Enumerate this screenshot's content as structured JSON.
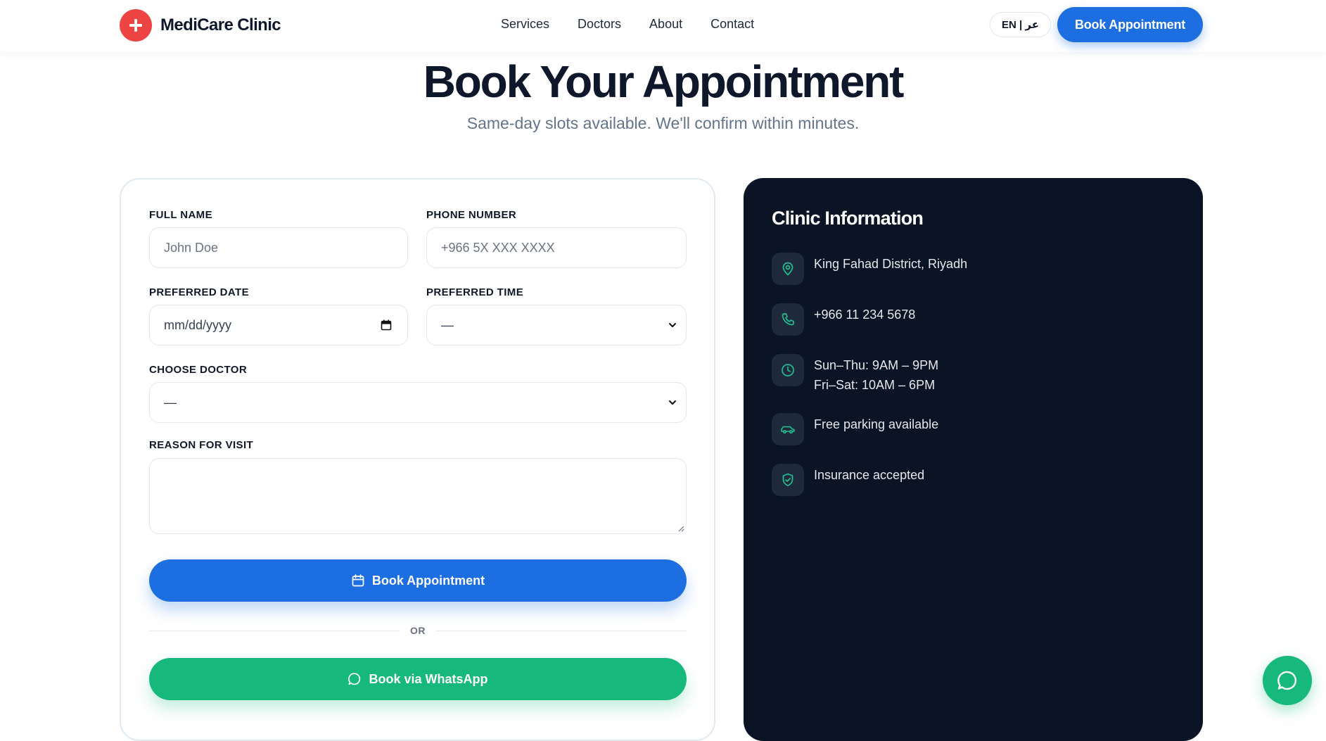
{
  "header": {
    "brand_name": "MediCare Clinic",
    "nav": [
      "Services",
      "Doctors",
      "About",
      "Contact"
    ],
    "lang_toggle": "EN | عر",
    "cta": "Book Appointment"
  },
  "hero": {
    "title": "Book Your Appointment",
    "subtitle": "Same-day slots available. We'll confirm within minutes."
  },
  "form": {
    "full_name": {
      "label": "FULL NAME",
      "placeholder": "John Doe"
    },
    "phone": {
      "label": "PHONE NUMBER",
      "placeholder": "+966 5X XXX XXXX"
    },
    "date": {
      "label": "PREFERRED DATE",
      "placeholder": "mm/dd/yyyy"
    },
    "time": {
      "label": "PREFERRED TIME",
      "value": "—"
    },
    "doctor": {
      "label": "CHOOSE DOCTOR",
      "value": "—"
    },
    "reason": {
      "label": "REASON FOR VISIT"
    },
    "submit": "Book Appointment",
    "divider": "OR",
    "whatsapp": "Book via WhatsApp"
  },
  "info": {
    "title": "Clinic Information",
    "items": [
      {
        "icon": "location-pin-icon",
        "lines": [
          "King Fahad District, Riyadh"
        ]
      },
      {
        "icon": "phone-icon",
        "lines": [
          "+966 11 234 5678"
        ]
      },
      {
        "icon": "clock-icon",
        "lines": [
          "Sun–Thu: 9AM – 9PM",
          "Fri–Sat: 10AM – 6PM"
        ]
      },
      {
        "icon": "car-icon",
        "lines": [
          "Free parking available"
        ]
      },
      {
        "icon": "shield-check-icon",
        "lines": [
          "Insurance accepted"
        ]
      }
    ]
  },
  "colors": {
    "primary": "#1d6ee0",
    "whatsapp": "#16b97b",
    "brand_red": "#ef4444",
    "info_bg": "#0b1425",
    "info_icon_accent": "#1fbf8f"
  }
}
